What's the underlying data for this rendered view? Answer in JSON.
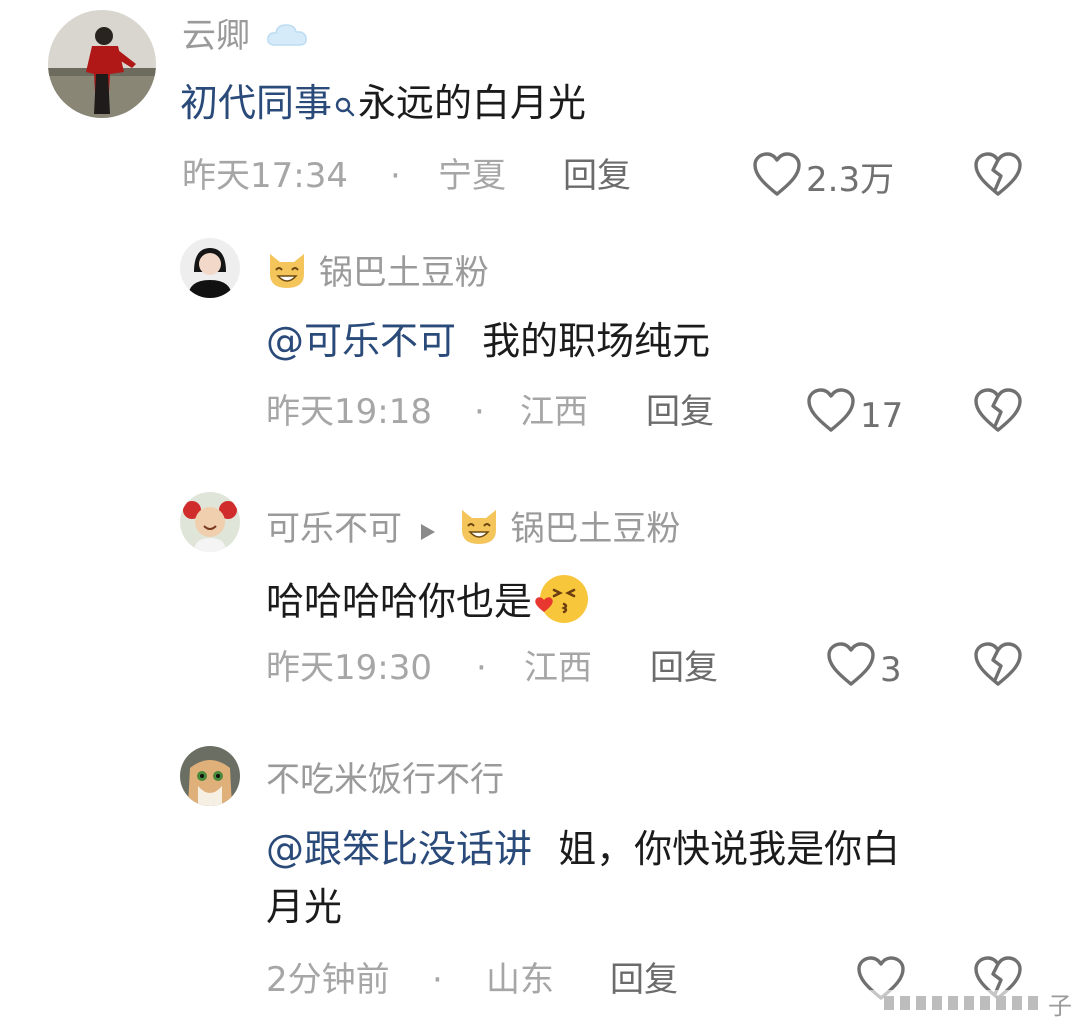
{
  "comments": [
    {
      "username": "云卿",
      "mention": "初代同事",
      "text": "永远的白月光",
      "time": "昨天17:34",
      "location": "宁夏",
      "reply_label": "回复",
      "likes": "2.3万"
    },
    {
      "username": "锅巴土豆粉",
      "mention": "@可乐不可",
      "text": "我的职场纯元",
      "time": "昨天19:18",
      "location": "江西",
      "reply_label": "回复",
      "likes": "17"
    },
    {
      "username": "可乐不可",
      "reply_to": "锅巴土豆粉",
      "text": "哈哈哈哈你也是",
      "time": "昨天19:30",
      "location": "江西",
      "reply_label": "回复",
      "likes": "3"
    },
    {
      "username": "不吃米饭行不行",
      "mention": "@跟笨比没话讲",
      "text_line1": "姐，你快说我是你白",
      "text_line2": "月光",
      "time": "2分钟前",
      "location": "山东",
      "reply_label": "回复",
      "likes": ""
    }
  ],
  "separator": "·",
  "watermark": "子",
  "icons": {
    "cloud": "cloud-icon",
    "search": "search-icon",
    "cat": "cat-emoji-icon",
    "triangle": "reply-to-triangle-icon",
    "heart": "heart-icon",
    "broken_heart": "broken-heart-icon",
    "kiss": "kiss-emoji-icon"
  },
  "colors": {
    "mention": "#2a4a7a",
    "meta": "#a6a6a6",
    "username": "#9a9a9a"
  }
}
